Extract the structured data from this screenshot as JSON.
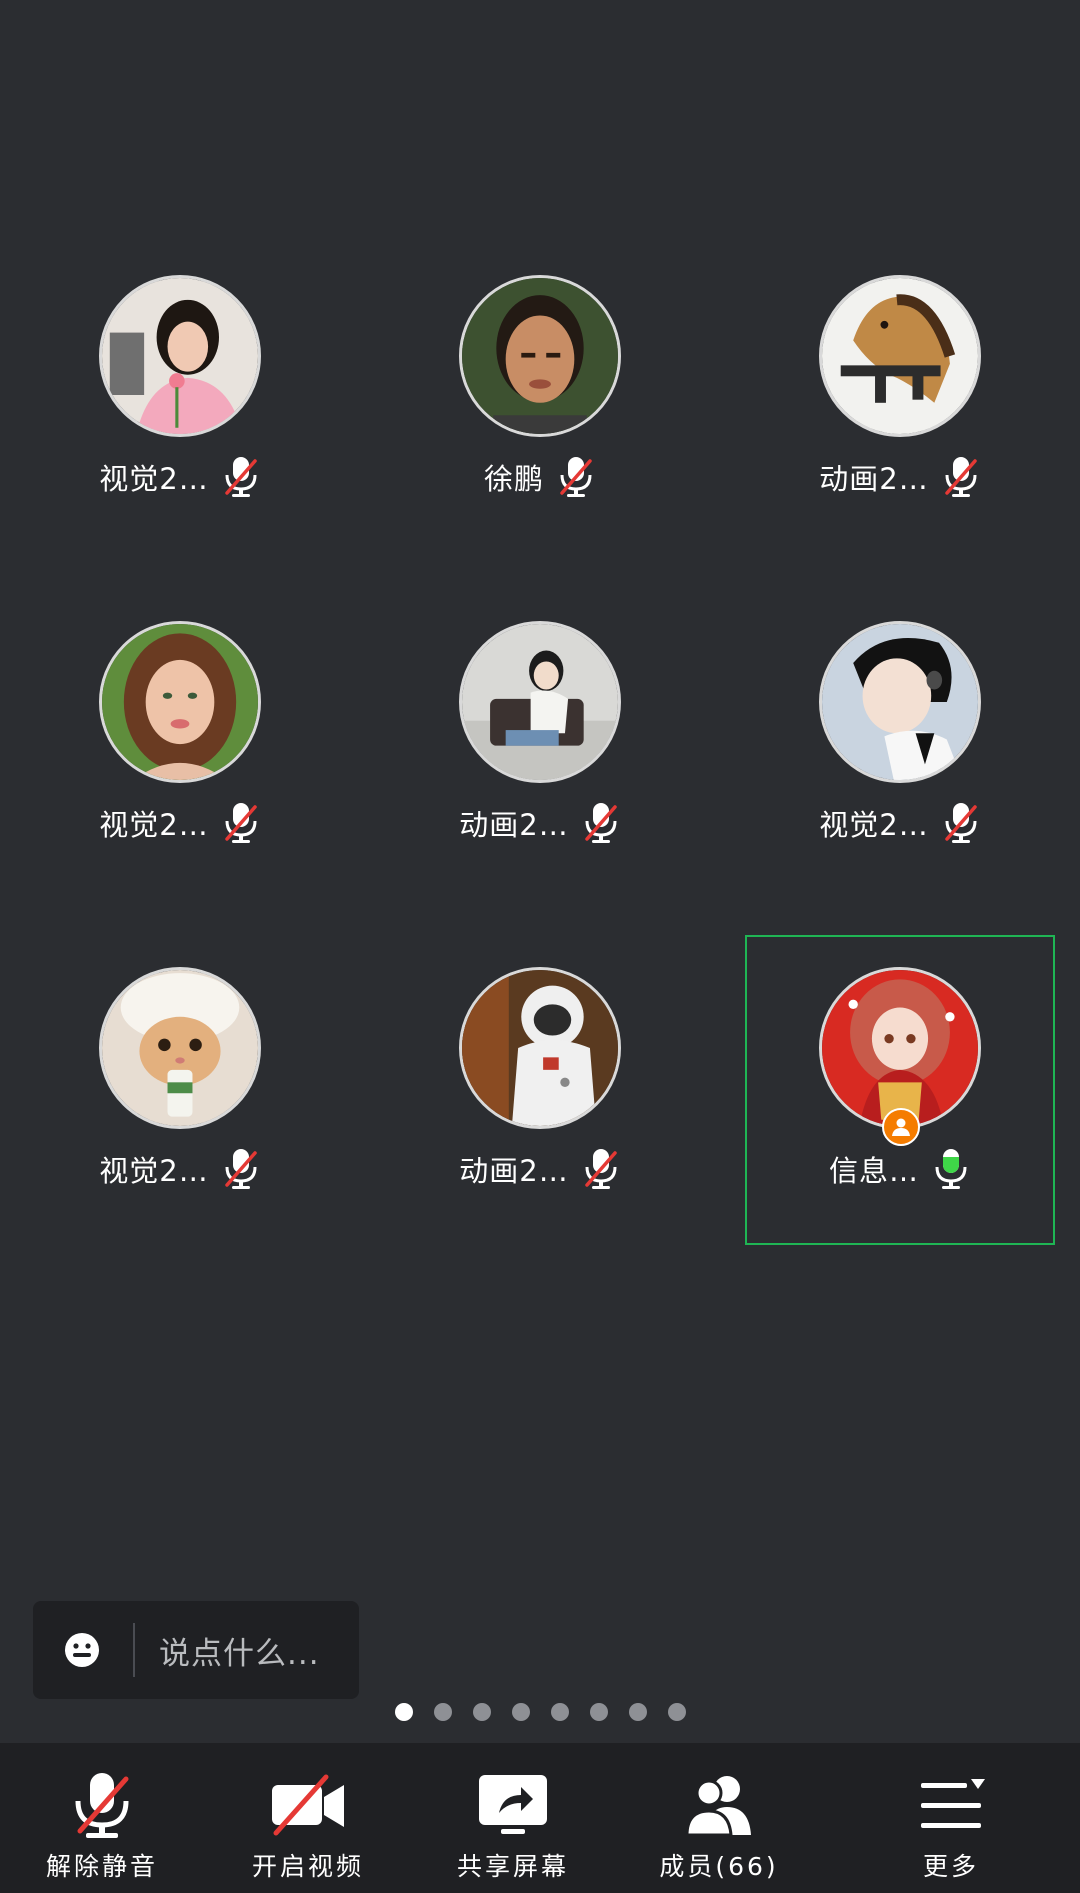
{
  "participants": [
    {
      "name": "视觉2…",
      "mic": "muted"
    },
    {
      "name": "徐鹏",
      "mic": "muted"
    },
    {
      "name": "动画2…",
      "mic": "muted"
    },
    {
      "name": "视觉2…",
      "mic": "muted"
    },
    {
      "name": "动画2…",
      "mic": "muted"
    },
    {
      "name": "视觉2…",
      "mic": "muted"
    },
    {
      "name": "视觉2…",
      "mic": "muted"
    },
    {
      "name": "动画2…",
      "mic": "muted"
    },
    {
      "name": "信息…",
      "mic": "active",
      "is_self": true,
      "host_badge_icon": "person-icon"
    }
  ],
  "chat": {
    "emoji_icon": "emoji-icon",
    "placeholder": "说点什么..."
  },
  "pagination": {
    "total": 8,
    "current": 1
  },
  "toolbar": {
    "unmute_label": "解除静音",
    "video_label": "开启视频",
    "share_label": "共享屏幕",
    "members_label": "成员(66)",
    "more_label": "更多"
  },
  "colors": {
    "background": "#2b2d31",
    "toolbar_bg": "#1f2023",
    "active_speaker": "#1fb554",
    "muted_slash": "#e53935",
    "mic_active": "#3fd648",
    "host_badge": "#f57c00"
  }
}
